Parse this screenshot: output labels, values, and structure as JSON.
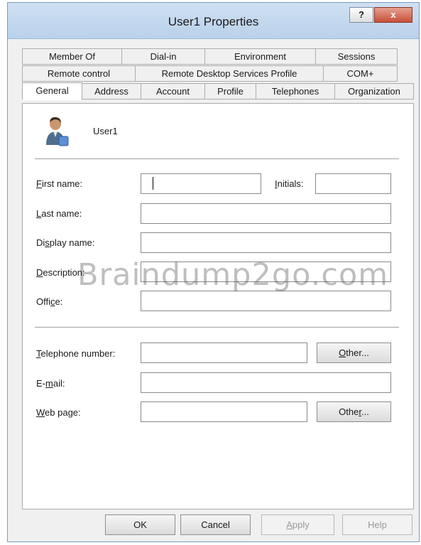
{
  "window": {
    "title": "User1 Properties",
    "help_label": "?",
    "close_label": "x"
  },
  "tabs": {
    "row1": [
      "Member Of",
      "Dial-in",
      "Environment",
      "Sessions"
    ],
    "row2": [
      "Remote control",
      "Remote Desktop Services Profile",
      "COM+"
    ],
    "row3": [
      "General",
      "Address",
      "Account",
      "Profile",
      "Telephones",
      "Organization"
    ],
    "active": "General"
  },
  "user": {
    "name": "User1",
    "icon": "user-icon"
  },
  "form": {
    "first_name": {
      "label_u": "F",
      "label_rest": "irst name:",
      "value": ""
    },
    "initials": {
      "label_u": "I",
      "label_rest": "nitials:",
      "value": ""
    },
    "last_name": {
      "label_u": "L",
      "label_rest": "ast name:",
      "value": ""
    },
    "display_name": {
      "label_pre": "Di",
      "label_u": "s",
      "label_rest": "play name:",
      "value": ""
    },
    "description": {
      "label_u": "D",
      "label_rest": "escription:",
      "value": ""
    },
    "office": {
      "label_pre": "Offi",
      "label_u": "c",
      "label_rest": "e:",
      "value": ""
    },
    "telephone": {
      "label_u": "T",
      "label_rest": "elephone number:",
      "value": ""
    },
    "email": {
      "label_pre": "E-",
      "label_u": "m",
      "label_rest": "ail:",
      "value": ""
    },
    "web_page": {
      "label_u": "W",
      "label_rest": "eb page:",
      "value": ""
    }
  },
  "buttons": {
    "other_phone": {
      "u": "O",
      "rest": "ther..."
    },
    "other_web": {
      "pre": "Othe",
      "u": "r",
      "rest": "..."
    },
    "ok": "OK",
    "cancel": "Cancel",
    "apply": {
      "u": "A",
      "rest": "pply"
    },
    "help": "Help"
  },
  "watermark": "Braindump2go.com"
}
